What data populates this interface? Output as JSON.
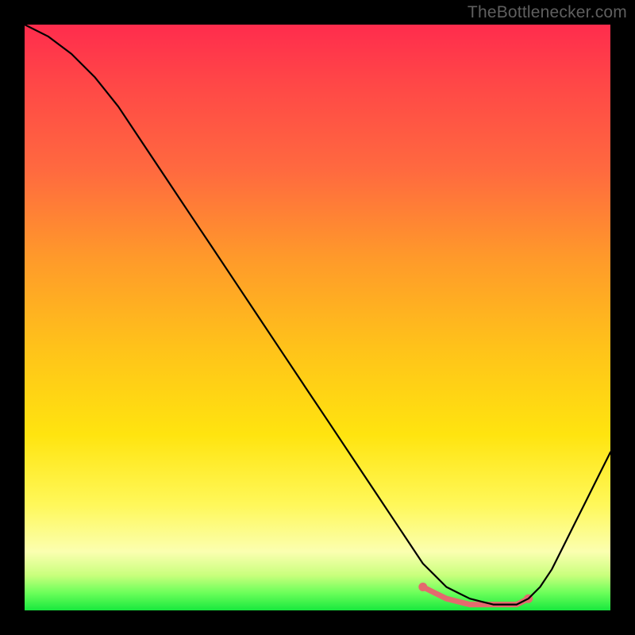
{
  "watermark": "TheBottlenecker.com",
  "colors": {
    "frame": "#000000",
    "watermark": "#5f5f5f",
    "curve": "#000000",
    "highlight": "#e46a6e",
    "gradient_stops": [
      "#ff2c4d",
      "#ff4747",
      "#ff6a3f",
      "#ff9a2a",
      "#ffc21a",
      "#ffe40f",
      "#fff85a",
      "#fbffb0",
      "#c9ff7d",
      "#6cff5a",
      "#18e83e"
    ]
  },
  "chart_data": {
    "type": "line",
    "title": "",
    "xlabel": "",
    "ylabel": "",
    "xlim": [
      0,
      100
    ],
    "ylim": [
      0,
      100
    ],
    "grid": false,
    "legend": false,
    "series": [
      {
        "name": "bottleneck-curve",
        "x": [
          0,
          4,
          8,
          12,
          16,
          20,
          24,
          28,
          32,
          36,
          40,
          44,
          48,
          52,
          56,
          60,
          64,
          68,
          70,
          72,
          74,
          76,
          78,
          80,
          82,
          84,
          86,
          88,
          90,
          92,
          94,
          96,
          98,
          100
        ],
        "values": [
          100,
          98,
          95,
          91,
          86,
          80,
          74,
          68,
          62,
          56,
          50,
          44,
          38,
          32,
          26,
          20,
          14,
          8,
          6,
          4,
          3,
          2,
          1.5,
          1,
          1,
          1,
          2,
          4,
          7,
          11,
          15,
          19,
          23,
          27
        ]
      }
    ],
    "highlight": {
      "name": "optimal-range",
      "x": [
        68,
        70,
        72,
        74,
        76,
        78,
        80,
        82,
        84,
        86
      ],
      "values": [
        4,
        3,
        2,
        1.5,
        1,
        1,
        1,
        1,
        1,
        2
      ],
      "endpoint_dots": [
        {
          "x": 68,
          "y": 4
        },
        {
          "x": 86,
          "y": 2
        }
      ]
    }
  }
}
